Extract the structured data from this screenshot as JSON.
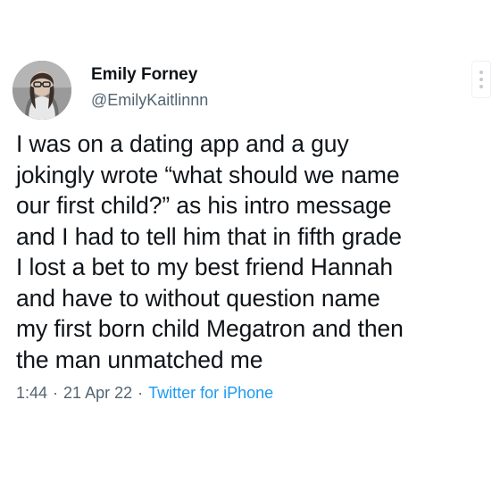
{
  "tweet": {
    "author": {
      "display_name": "Emily Forney",
      "handle": "@EmilyKaitlinnn"
    },
    "text": "I was on a dating app and a guy\njokingly wrote “what should we name\nour first child?” as his intro message\nand I had to tell him that in fifth grade\nI lost a bet to my best friend Hannah\nand have to without question name\nmy first born child Megatron and then\nthe man unmatched me",
    "time": "1:44",
    "date": "21 Apr 22",
    "source": "Twitter for iPhone",
    "separator": "·"
  },
  "icons": {
    "more": "more-vertical-icon"
  }
}
